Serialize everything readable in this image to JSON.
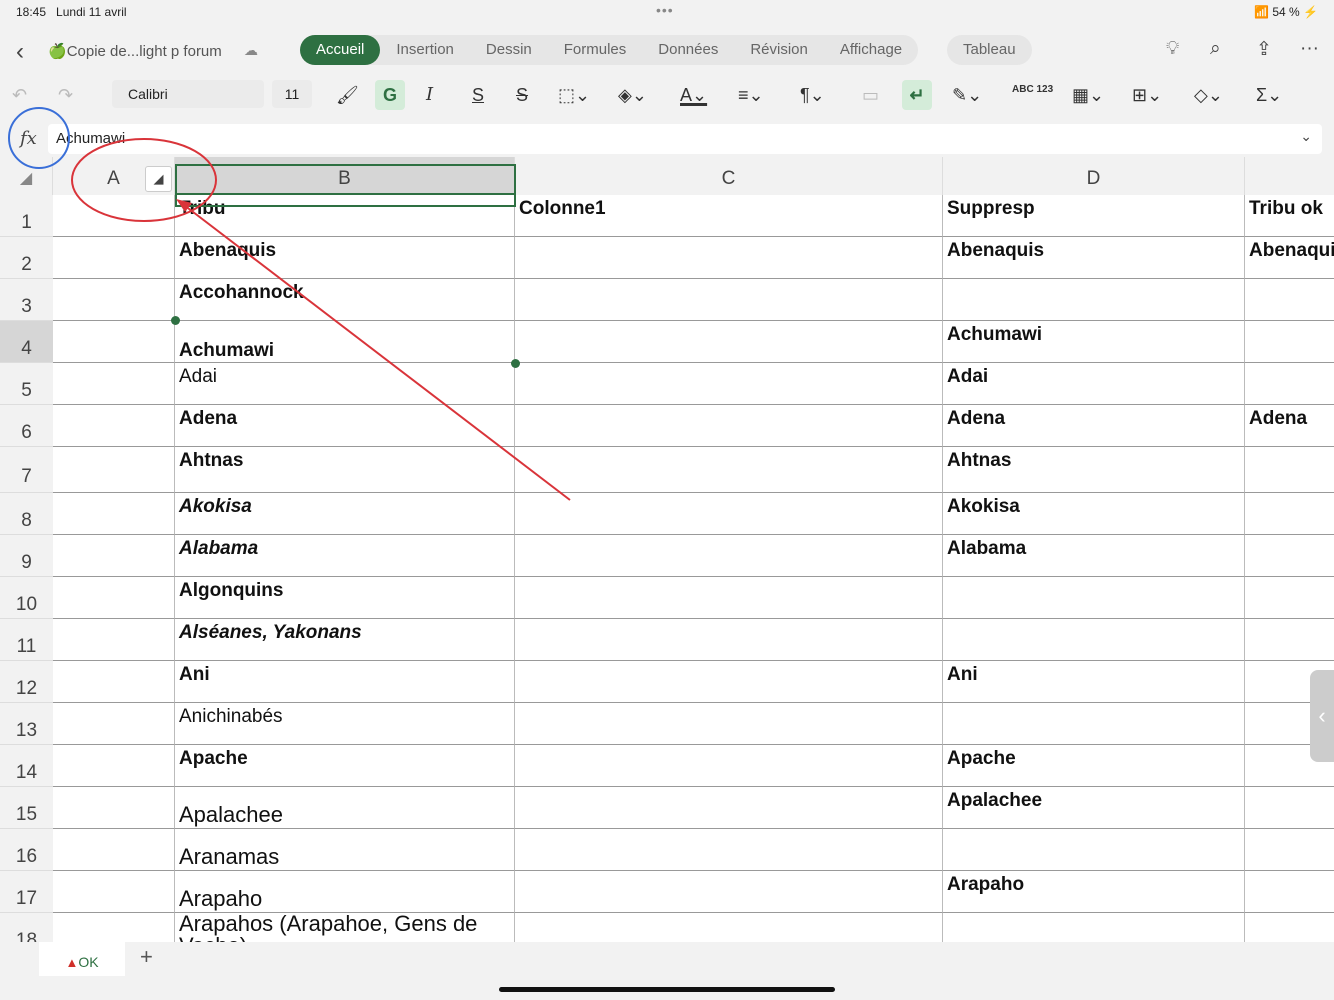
{
  "status": {
    "time": "18:45",
    "date": "Lundi 11 avril",
    "battery": "54 %"
  },
  "header": {
    "back_icon": "chevron-left-icon",
    "doc_title": "Copie de...light p forum",
    "tabs": [
      "Accueil",
      "Insertion",
      "Dessin",
      "Formules",
      "Données",
      "Révision",
      "Affichage"
    ],
    "active_tab": "Accueil",
    "table_tab": "Tableau"
  },
  "toolbar": {
    "font": "Calibri",
    "size": "11",
    "bold_label": "G",
    "number_format": "ABC 123"
  },
  "formula": {
    "fx": "fx",
    "value": "Achumawi"
  },
  "columns": [
    "A",
    "B",
    "C",
    "D",
    ""
  ],
  "rows": [
    {
      "n": "1",
      "cells": [
        [
          "",
          ""
        ],
        [
          "Tribu",
          "b"
        ],
        [
          "Colonne1",
          "b"
        ],
        [
          "Suppresp",
          "b"
        ],
        [
          "Tribu ok",
          "b"
        ]
      ]
    },
    {
      "n": "2",
      "cells": [
        [
          "",
          ""
        ],
        [
          "Abenaquis",
          "b"
        ],
        [
          "",
          ""
        ],
        [
          "Abenaquis",
          "b"
        ],
        [
          "Abenaquis",
          "b"
        ]
      ]
    },
    {
      "n": "3",
      "cells": [
        [
          "",
          ""
        ],
        [
          "Accohannock",
          "b"
        ],
        [
          "",
          ""
        ],
        [
          "",
          ""
        ],
        [
          "",
          ""
        ]
      ]
    },
    {
      "n": "4",
      "cells": [
        [
          "",
          ""
        ],
        [
          "Achumawi",
          "b bot"
        ],
        [
          "",
          ""
        ],
        [
          "Achumawi",
          "b"
        ],
        [
          "",
          ""
        ]
      ]
    },
    {
      "n": "5",
      "cells": [
        [
          "",
          ""
        ],
        [
          "Adai",
          "n"
        ],
        [
          "",
          ""
        ],
        [
          "Adai",
          "b"
        ],
        [
          "",
          ""
        ]
      ]
    },
    {
      "n": "6",
      "cells": [
        [
          "",
          ""
        ],
        [
          "Adena",
          "b"
        ],
        [
          "",
          ""
        ],
        [
          "Adena",
          "b"
        ],
        [
          "Adena",
          "b"
        ]
      ]
    },
    {
      "n": "7",
      "cells": [
        [
          "",
          ""
        ],
        [
          "Ahtnas",
          "b"
        ],
        [
          "",
          ""
        ],
        [
          "Ahtnas",
          "b"
        ],
        [
          "",
          ""
        ]
      ]
    },
    {
      "n": "8",
      "cells": [
        [
          "",
          ""
        ],
        [
          "Akokisa",
          "bi"
        ],
        [
          "",
          ""
        ],
        [
          "Akokisa",
          "b"
        ],
        [
          "",
          ""
        ]
      ]
    },
    {
      "n": "9",
      "cells": [
        [
          "",
          ""
        ],
        [
          "Alabama",
          "bi"
        ],
        [
          "",
          ""
        ],
        [
          "Alabama",
          "b"
        ],
        [
          "",
          ""
        ]
      ]
    },
    {
      "n": "10",
      "cells": [
        [
          "",
          ""
        ],
        [
          "Algonquins",
          "b"
        ],
        [
          "",
          ""
        ],
        [
          "",
          ""
        ],
        [
          "",
          ""
        ]
      ]
    },
    {
      "n": "11",
      "cells": [
        [
          "",
          ""
        ],
        [
          "Alséanes, Yakonans",
          "bi"
        ],
        [
          "",
          ""
        ],
        [
          "",
          ""
        ],
        [
          "",
          ""
        ]
      ]
    },
    {
      "n": "12",
      "cells": [
        [
          "",
          ""
        ],
        [
          "Ani",
          "b"
        ],
        [
          "",
          ""
        ],
        [
          "Ani",
          "b"
        ],
        [
          "",
          ""
        ]
      ]
    },
    {
      "n": "13",
      "cells": [
        [
          "",
          ""
        ],
        [
          "Anichinabés",
          "n"
        ],
        [
          "",
          ""
        ],
        [
          "",
          ""
        ],
        [
          "",
          ""
        ]
      ]
    },
    {
      "n": "14",
      "cells": [
        [
          "",
          ""
        ],
        [
          "Apache",
          "b"
        ],
        [
          "",
          ""
        ],
        [
          "Apache",
          "b"
        ],
        [
          "",
          ""
        ]
      ]
    },
    {
      "n": "15",
      "cells": [
        [
          "",
          ""
        ],
        [
          "Apalachee",
          "L"
        ],
        [
          "",
          ""
        ],
        [
          "Apalachee",
          "b"
        ],
        [
          "",
          ""
        ]
      ]
    },
    {
      "n": "16",
      "cells": [
        [
          "",
          ""
        ],
        [
          "Aranamas",
          "L"
        ],
        [
          "",
          ""
        ],
        [
          "",
          ""
        ],
        [
          "",
          ""
        ]
      ]
    },
    {
      "n": "17",
      "cells": [
        [
          "",
          ""
        ],
        [
          "Arapaho",
          "L"
        ],
        [
          "",
          ""
        ],
        [
          "Arapaho",
          "b"
        ],
        [
          "",
          ""
        ]
      ]
    },
    {
      "n": "18",
      "cells": [
        [
          "",
          ""
        ],
        [
          "Arapahos (Arapahoe, Gens de Vache)",
          "L wrap"
        ],
        [
          "",
          ""
        ],
        [
          "",
          ""
        ],
        [
          "",
          ""
        ]
      ]
    }
  ],
  "sheets": [
    {
      "label": "OK",
      "warning_icon": "warning-triangle-icon"
    }
  ],
  "add_sheet": "+",
  "colors": {
    "accent": "#2e7042",
    "annotation_red": "#d9343a",
    "annotation_blue": "#3a6fd8"
  }
}
